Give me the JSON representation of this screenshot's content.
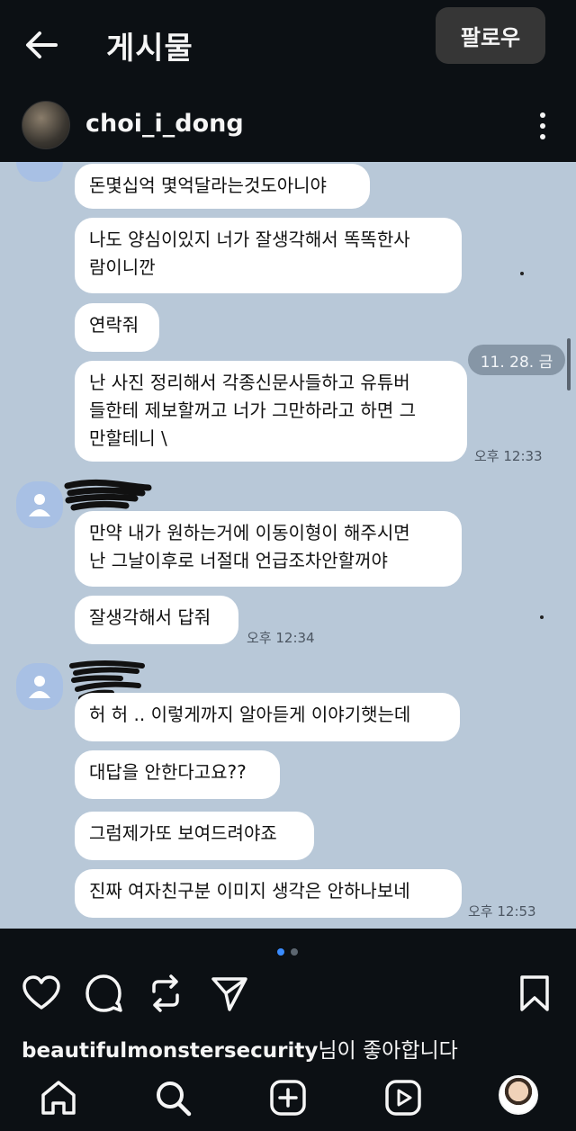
{
  "header": {
    "title": "게시물",
    "follow_label": "팔로우"
  },
  "author": {
    "username": "choi_i_dong"
  },
  "post": {
    "date_pill": "11. 28. 금",
    "messages": [
      "돈몇십억 몇억달라는것도아니야",
      "나도 양심이있지 너가 잘생각해서 똑똑한사\n람이니깐",
      "연락줘",
      "난 사진 정리해서 각종신문사들하고 유튜버\n들한테 제보할꺼고 너가 그만하라고 하면 그\n만할테니 \\",
      "만약 내가 원하는거에 이동이형이 해주시면\n난 그날이후로 너절대 언급조차안할꺼야",
      "잘생각해서 답줘",
      "허 허 .. 이렇게까지 알아듣게 이야기햇는데",
      "대답을 안한다고요??",
      "그럼제가또 보여드려야죠",
      "진짜 여자친구분 이미지 생각은 안하나보네"
    ],
    "times": [
      "오후 12:33",
      "오후 12:34",
      "오후 12:53"
    ]
  },
  "carousel": {
    "active_index": 1,
    "count": 2
  },
  "likes": {
    "username": "beautifulmonstersecurity",
    "suffix": "님이 좋아합니다"
  },
  "icons": {
    "back": "back-arrow-icon",
    "more": "more-vertical-icon",
    "like": "heart-icon",
    "comment": "comment-icon",
    "repost": "repost-icon",
    "share": "send-icon",
    "save": "bookmark-icon",
    "home": "home-icon",
    "search": "search-icon",
    "create": "plus-square-icon",
    "reels": "reels-icon"
  },
  "colors": {
    "background": "#0c1014",
    "chat_bg": "#b8c8d8",
    "bubble": "#ffffff",
    "button": "#363636"
  }
}
